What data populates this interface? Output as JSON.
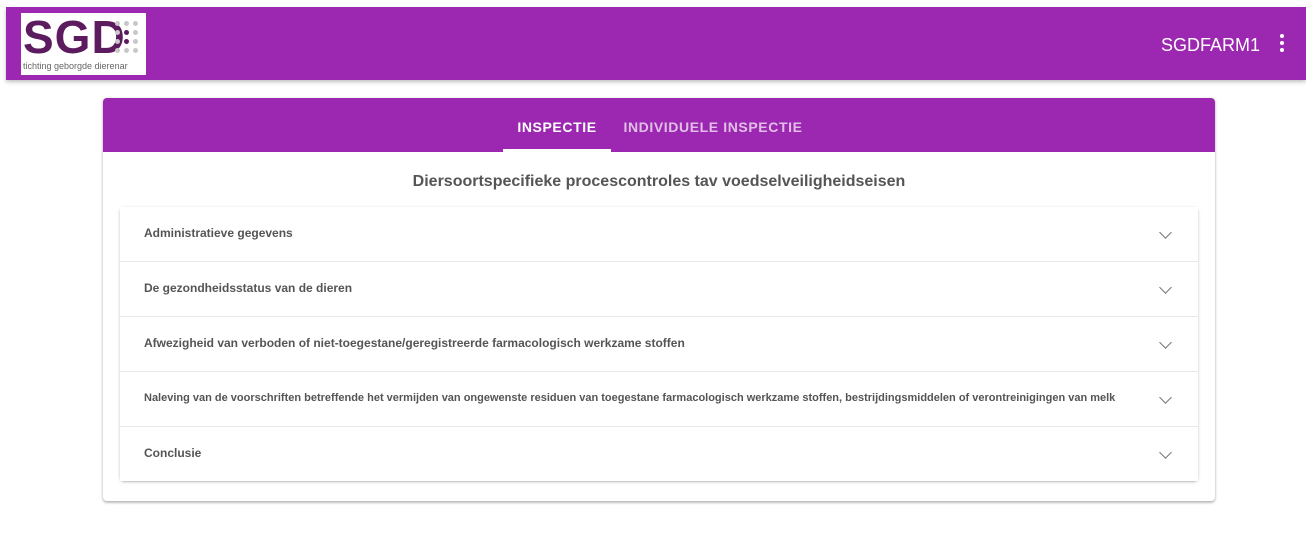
{
  "header": {
    "logo_text": "SGD",
    "logo_subtitle": "tichting geborgde dierenar",
    "user": "SGDFARM1"
  },
  "tabs": [
    {
      "label": "INSPECTIE",
      "active": true
    },
    {
      "label": "INDIVIDUELE INSPECTIE",
      "active": false
    }
  ],
  "main": {
    "title": "Diersoortspecifieke procescontroles tav voedselveiligheidseisen",
    "panels": [
      {
        "label": "Administratieve gegevens"
      },
      {
        "label": "De gezondheidsstatus van de dieren"
      },
      {
        "label": "Afwezigheid van verboden of niet-toegestane/geregistreerde farmacologisch werkzame stoffen"
      },
      {
        "label": "Naleving van de voorschriften betreffende het vermijden van ongewenste residuen van toegestane farmacologisch werkzame stoffen, bestrijdingsmiddelen of verontreinigingen van melk"
      },
      {
        "label": "Conclusie"
      }
    ]
  },
  "icons": [
    "more-vert-icon",
    "chevron-down-icon"
  ],
  "colors": {
    "primary": "#9c27b0",
    "logo": "#5c1a5f"
  }
}
